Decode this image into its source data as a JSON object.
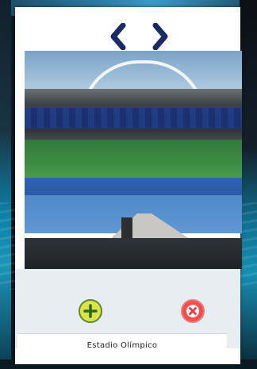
{
  "card": {
    "title_small": "",
    "title_big": ""
  },
  "navigation": {
    "prev_icon": "chevron-left-icon",
    "next_icon": "chevron-right-icon",
    "color": "#1b2a63"
  },
  "actions": {
    "add_icon": "plus-circle-icon",
    "add_color": "#dfe24c",
    "remove_icon": "x-circle-icon",
    "remove_color": "#f25050"
  },
  "location": {
    "name": "Estadio Olímpico"
  }
}
